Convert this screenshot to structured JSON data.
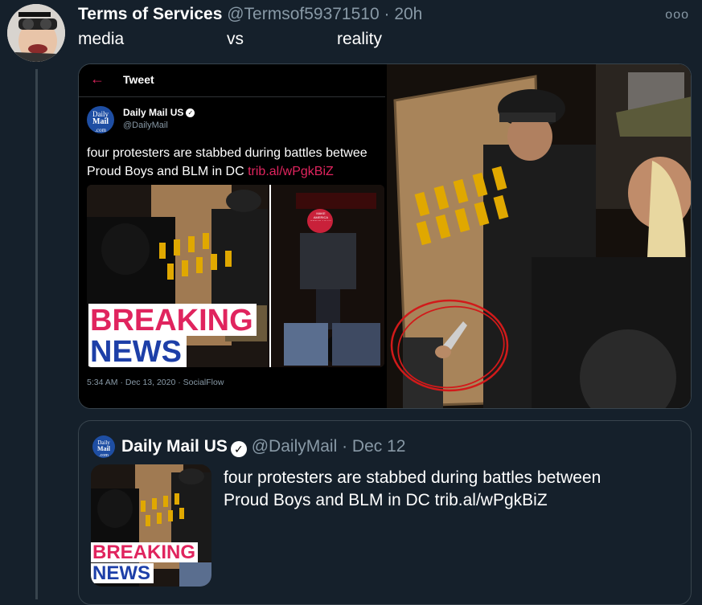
{
  "tweet": {
    "author_name": "Terms of Services",
    "author_handle": "@Termsof59371510",
    "time": "· 20h",
    "more_label": "ooo",
    "text_left": "media",
    "text_mid": "vs",
    "text_right": "reality"
  },
  "screenshot": {
    "back_icon": "←",
    "title": "Tweet",
    "logo_line1": "Daily",
    "logo_line2": "Mail",
    "logo_line3": ".com",
    "account_name": "Daily Mail US",
    "account_handle": "@DailyMail",
    "text_line1": "four protesters are stabbed during battles betwee",
    "text_line2": "Proud Boys and BLM in DC ",
    "link": "trib.al/wPgkBiZ",
    "breaking_label": "BREAKING",
    "news_label": "NEWS",
    "timestamp": "5:34 AM · Dec 13, 2020 · SocialFlow",
    "hat_text": "MAKE AMERICA GREAT AGAIN"
  },
  "quote": {
    "logo_line1": "Daily",
    "logo_line2": "Mail",
    "logo_line3": ".com",
    "name": "Daily Mail US",
    "handle": "@DailyMail",
    "date": "· Dec 12",
    "text_line1": "four protesters are stabbed during battles between",
    "text_line2": "Proud Boys and BLM in DC trib.al/wPgkBiZ",
    "breaking_label": "BREAKING",
    "news_label": "NEWS"
  },
  "icons": [
    "avatar",
    "back-arrow-icon",
    "verified-badge-icon",
    "more-options-icon",
    "knife",
    "red-circle-annotation"
  ],
  "colors": {
    "background": "#15202b",
    "muted": "#8899a6",
    "link_red": "#e0245e",
    "breaking_red": "#e0245e",
    "news_blue": "#1d3fa8"
  }
}
